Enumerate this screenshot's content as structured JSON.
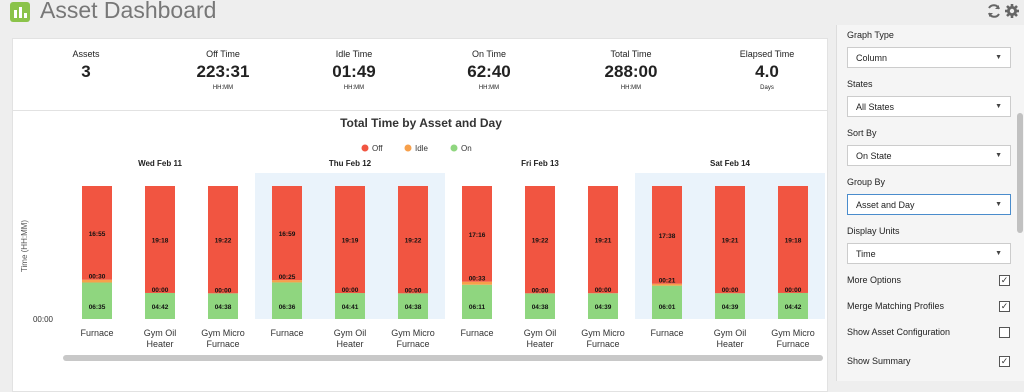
{
  "header": {
    "title": "Asset Dashboard",
    "app_icon": "bar-chart-icon",
    "refresh_icon": "refresh-icon",
    "settings_icon": "gear-icon"
  },
  "summary": [
    {
      "label": "Assets",
      "value": "3",
      "unit": ""
    },
    {
      "label": "Off Time",
      "value": "223:31",
      "unit": "HH:MM"
    },
    {
      "label": "Idle Time",
      "value": "01:49",
      "unit": "HH:MM"
    },
    {
      "label": "On Time",
      "value": "62:40",
      "unit": "HH:MM"
    },
    {
      "label": "Total Time",
      "value": "288:00",
      "unit": "HH:MM"
    },
    {
      "label": "Elapsed Time",
      "value": "4.0",
      "unit": "Days"
    }
  ],
  "chart_data": {
    "type": "bar",
    "stacked": true,
    "title": "Total Time by Asset and Day",
    "ylabel": "Time (HH:MM)",
    "ytick": "00:00",
    "legend": [
      "Off",
      "Idle",
      "On"
    ],
    "colors": {
      "Off": "#f15541",
      "Idle": "#f7a04b",
      "On": "#8fd67f"
    },
    "groups": [
      "Wed Feb 11",
      "Thu Feb 12",
      "Fri Feb 13",
      "Sat Feb 14"
    ],
    "categories": [
      "Furnace",
      "Gym Oil\nHeater",
      "Gym Micro\nFurnace",
      "Furnace",
      "Gym Oil\nHeater",
      "Gym Micro\nFurnace",
      "Furnace",
      "Gym Oil\nHeater",
      "Gym Micro\nFurnace",
      "Furnace",
      "Gym Oil\nHeater",
      "Gym Micro\nFurnace"
    ],
    "series": [
      {
        "name": "On",
        "values": [
          "06:35",
          "04:42",
          "04:38",
          "06:36",
          "04:41",
          "04:38",
          "06:11",
          "04:38",
          "04:39",
          "06:01",
          "04:39",
          "04:42"
        ]
      },
      {
        "name": "Idle",
        "values": [
          "00:30",
          "00:00",
          "00:00",
          "00:25",
          "00:00",
          "00:00",
          "00:33",
          "00:00",
          "00:00",
          "00:21",
          "00:00",
          "00:00"
        ]
      },
      {
        "name": "Off",
        "values": [
          "16:55",
          "19:18",
          "19:22",
          "16:59",
          "19:19",
          "19:22",
          "17:16",
          "19:22",
          "19:21",
          "17:38",
          "19:21",
          "19:18"
        ]
      }
    ]
  },
  "panel": {
    "graph_type": {
      "label": "Graph Type",
      "value": "Column"
    },
    "states": {
      "label": "States",
      "value": "All States"
    },
    "sort_by": {
      "label": "Sort By",
      "value": "On State"
    },
    "group_by": {
      "label": "Group By",
      "value": "Asset and Day"
    },
    "display_units": {
      "label": "Display Units",
      "value": "Time"
    },
    "checks": [
      {
        "label": "More Options",
        "checked": true
      },
      {
        "label": "Merge Matching Profiles",
        "checked": true
      },
      {
        "label": "Show Asset Configuration",
        "checked": false
      },
      {
        "label": "Show Summary",
        "checked": true
      }
    ]
  }
}
